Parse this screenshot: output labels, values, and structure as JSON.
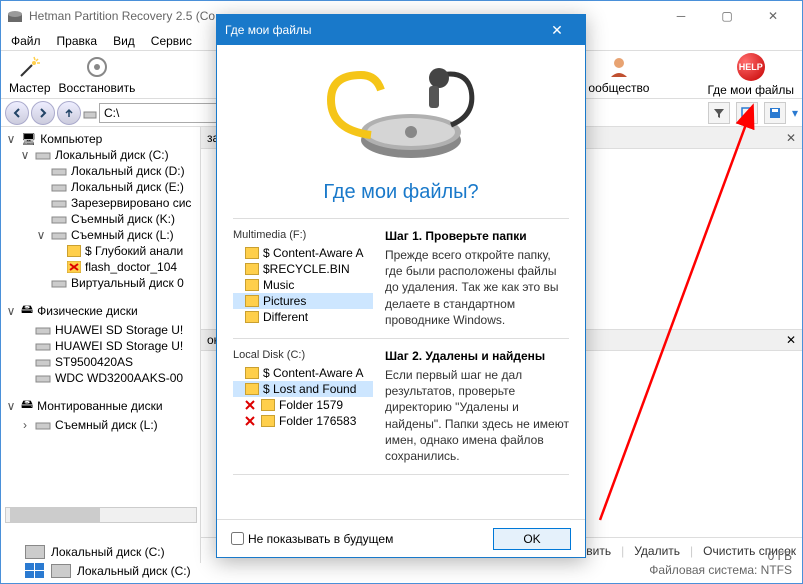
{
  "window": {
    "title": "Hetman Partition Recovery 2.5 (Co",
    "menus": [
      "Файл",
      "Правка",
      "Вид",
      "Сервис"
    ]
  },
  "toolbar": {
    "master": "Мастер",
    "restore": "Восстановить",
    "community": "ообщество",
    "help": "Где мои файлы"
  },
  "address": "C:\\",
  "preview": {
    "title": "зарительный просмотр",
    "recovery_title": "ок восстановления"
  },
  "sidebar": {
    "computer": "Компьютер",
    "items": [
      {
        "exp": "∨",
        "label": "Локальный диск (C:)",
        "indent": 1
      },
      {
        "exp": "",
        "label": "Локальный диск (D:)",
        "indent": 2
      },
      {
        "exp": "",
        "label": "Локальный диск (E:)",
        "indent": 2
      },
      {
        "exp": "",
        "label": "Зарезервировано сис",
        "indent": 2
      },
      {
        "exp": "",
        "label": "Съемный диск (K:)",
        "indent": 2
      },
      {
        "exp": "∨",
        "label": "Съемный диск (L:)",
        "indent": 2
      },
      {
        "exp": "",
        "label": "$ Глубокий анали",
        "indent": 3,
        "special": true
      },
      {
        "exp": "",
        "label": "flash_doctor_104",
        "indent": 3,
        "red": true
      },
      {
        "exp": "",
        "label": "Виртуальный диск 0",
        "indent": 2
      }
    ],
    "phys_header": "Физические диски",
    "phys": [
      "HUAWEI SD Storage U!",
      "HUAWEI SD Storage U!",
      "ST9500420AS",
      "WDC WD3200AAKS-00"
    ],
    "mounted_header": "Монтированные диски",
    "mounted": "Съемный диск (L:)"
  },
  "dialog": {
    "title": "Где мои файлы",
    "heading": "Где мои файлы?",
    "section1": {
      "left_header": "Multimedia (F:)",
      "folders": [
        "$ Content-Aware A",
        "$RECYCLE.BIN",
        "Music",
        "Pictures",
        "Different"
      ],
      "selected": "Pictures",
      "step_title": "Шаг 1. Проверьте папки",
      "step_text": "Прежде всего откройте папку, где были расположены файлы до удаления. Так же как это вы делаете в стандартном проводнике Windows."
    },
    "section2": {
      "left_header": "Local Disk (C:)",
      "folders": [
        "$ Content-Aware A",
        "$ Lost and Found",
        "Folder 1579",
        "Folder 176583"
      ],
      "selected": "$ Lost and Found",
      "step_title": "Шаг 2. Удалены и найдены",
      "step_text": "Если первый шаг не дал результатов, проверьте директорию \"Удалены и найдены\". Папки здесь не имеют имен, однако имена файлов сохранились."
    },
    "checkbox": "Не показывать в будущем",
    "ok": "OK"
  },
  "bottom": {
    "restore": "новить",
    "delete": "Удалить",
    "clear": "Очистить список"
  },
  "status": {
    "drive1": "Локальный диск (C:)",
    "drive2": "Локальный диск (C:)",
    "size": "0 ГБ",
    "fs": "Файловая система: NTFS"
  }
}
